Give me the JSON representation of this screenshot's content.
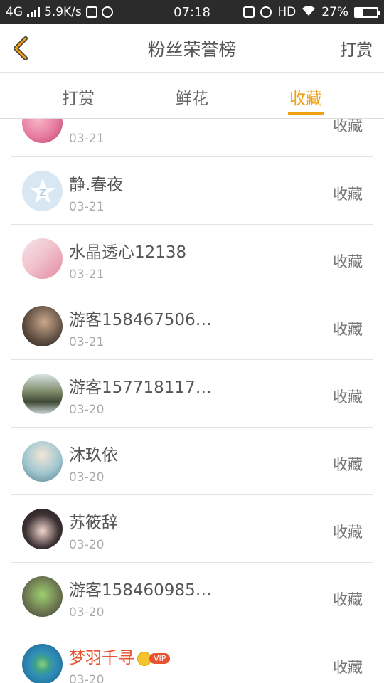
{
  "status_bar": {
    "network": "4G",
    "speed": "5.9K/s",
    "time": "07:18",
    "hd": "HD",
    "battery": "27%"
  },
  "header": {
    "title": "粉丝荣誉榜",
    "action": "打赏"
  },
  "tabs": [
    {
      "label": "打赏",
      "active": false
    },
    {
      "label": "鲜花",
      "active": false
    },
    {
      "label": "收藏",
      "active": true
    }
  ],
  "rows": [
    {
      "name": "",
      "date": "03-21",
      "action": "收藏",
      "vip": false,
      "avatar_color": "#e77aa0"
    },
    {
      "name": "静.春夜",
      "date": "03-21",
      "action": "收藏",
      "vip": false,
      "avatar_color": "#d8e7f2"
    },
    {
      "name": "水晶透心12138",
      "date": "03-21",
      "action": "收藏",
      "vip": false,
      "avatar_color": "#f1c4cf"
    },
    {
      "name": "游客158467506…",
      "date": "03-21",
      "action": "收藏",
      "vip": false,
      "avatar_color": "#5b4a3e"
    },
    {
      "name": "游客157718117…",
      "date": "03-20",
      "action": "收藏",
      "vip": false,
      "avatar_color": "#7c8a69"
    },
    {
      "name": "沐玖依",
      "date": "03-20",
      "action": "收藏",
      "vip": false,
      "avatar_color": "#9fc6cf"
    },
    {
      "name": "苏筱辞",
      "date": "03-20",
      "action": "收藏",
      "vip": false,
      "avatar_color": "#3d3234"
    },
    {
      "name": "游客158460985…",
      "date": "03-20",
      "action": "收藏",
      "vip": false,
      "avatar_color": "#6f7a52"
    },
    {
      "name": "梦羽千寻",
      "date": "03-20",
      "action": "收藏",
      "vip": true,
      "vip_label": "VIP",
      "avatar_color": "#2f8eb8"
    }
  ],
  "colors": {
    "accent": "#f0a011",
    "vip_name": "#e8522e"
  }
}
